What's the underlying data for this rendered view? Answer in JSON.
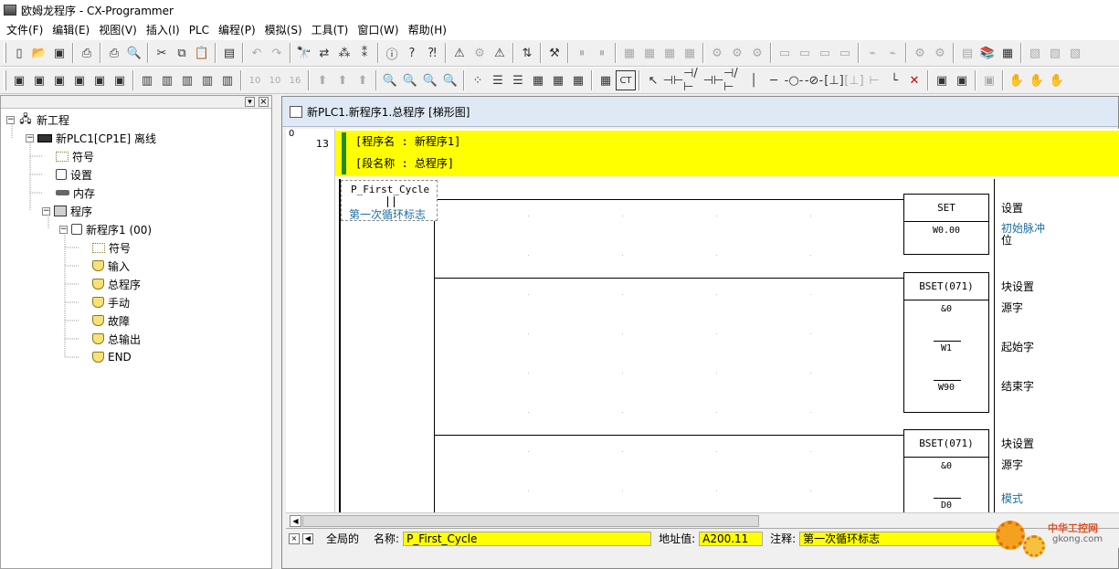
{
  "window": {
    "title": "欧姆龙程序 - CX-Programmer"
  },
  "menu": [
    "文件(F)",
    "编辑(E)",
    "视图(V)",
    "插入(I)",
    "PLC",
    "编程(P)",
    "模拟(S)",
    "工具(T)",
    "窗口(W)",
    "帮助(H)"
  ],
  "toolbar2": {
    "btn_10": "10",
    "btn_10b": "10",
    "btn_16": "16",
    "btn_ct": "CT"
  },
  "tree": {
    "root": "新工程",
    "plc": "新PLC1[CP1E] 离线",
    "symbols": "符号",
    "settings": "设置",
    "memory": "内存",
    "programs": "程序",
    "program1": "新程序1 (00)",
    "sections": [
      "符号",
      "输入",
      "总程序",
      "手动",
      "故障",
      "总输出",
      "END"
    ]
  },
  "document": {
    "title": "新PLC1.新程序1.总程序 [梯形图]",
    "rung_start": "0",
    "rung_number": "13",
    "comment_program": "[程序名 : 新程序1]",
    "comment_section": "[段名称 : 总程序]",
    "contact": {
      "name": "P_First_Cycle",
      "comment": "第一次循环标志"
    },
    "set_block": {
      "instr": "SET",
      "operand": "W0.00",
      "label": "设置",
      "comment_line1": "初始脉冲",
      "comment_line2": "位"
    },
    "bset1": {
      "instr": "BSET(071)",
      "op1": "&0",
      "op2": "W1",
      "op3": "W90",
      "label": "块设置",
      "l1": "源字",
      "l2": "起始字",
      "l3": "结束字"
    },
    "bset2": {
      "instr": "BSET(071)",
      "op1": "&0",
      "op2": "D0",
      "label": "块设置",
      "l1": "源字",
      "l2": "模式"
    }
  },
  "symbol_bar": {
    "scope": "全局的",
    "name_label": "名称:",
    "name_value": "P_First_Cycle",
    "addr_label": "地址值:",
    "addr_value": "A200.11",
    "comment_label": "注释:",
    "comment_value": "第一次循环标志"
  },
  "watermark": {
    "text1": "中华工控网",
    "text2": "gkong.com"
  }
}
